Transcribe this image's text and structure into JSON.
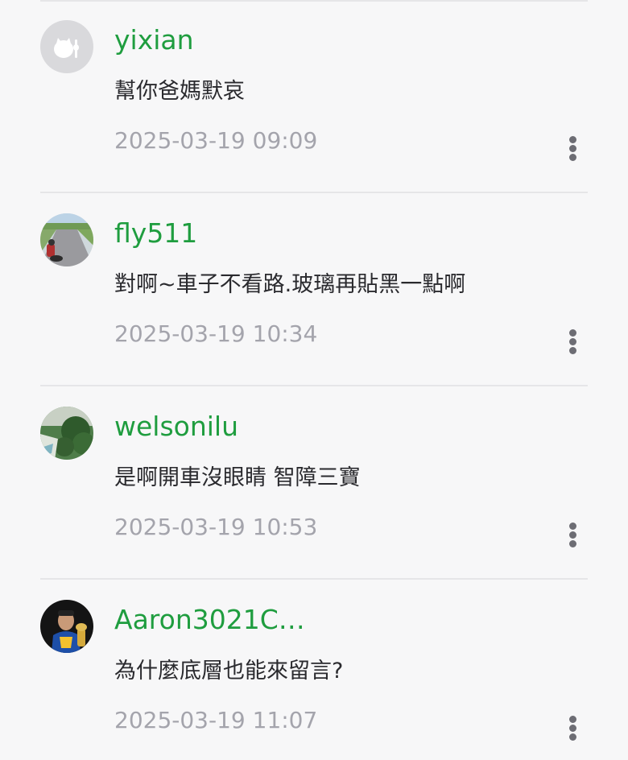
{
  "theme": {
    "username_color": "#1f9d3f",
    "time_color": "#a4a4ac",
    "text_color": "#2a2a2e"
  },
  "comments": [
    {
      "username": "yixian",
      "text": "幫你爸媽默哀",
      "time": "2025-03-19 09:09",
      "avatar_icon": "default-cat-avatar-icon",
      "more_icon": "vertical-dots-icon"
    },
    {
      "username": "fly511",
      "text": "對啊~車子不看路.玻璃再貼黑一點啊",
      "time": "2025-03-19 10:34",
      "avatar_icon": "road-photo-avatar",
      "more_icon": "vertical-dots-icon"
    },
    {
      "username": "welsonilu",
      "text": "是啊開車沒眼睛 智障三寶",
      "time": "2025-03-19 10:53",
      "avatar_icon": "garden-photo-avatar",
      "more_icon": "vertical-dots-icon"
    },
    {
      "username": "Aaron3021C…",
      "text": "為什麼底層也能來留言?",
      "time": "2025-03-19 11:07",
      "avatar_icon": "basketball-player-photo-avatar",
      "more_icon": "vertical-dots-icon"
    }
  ]
}
